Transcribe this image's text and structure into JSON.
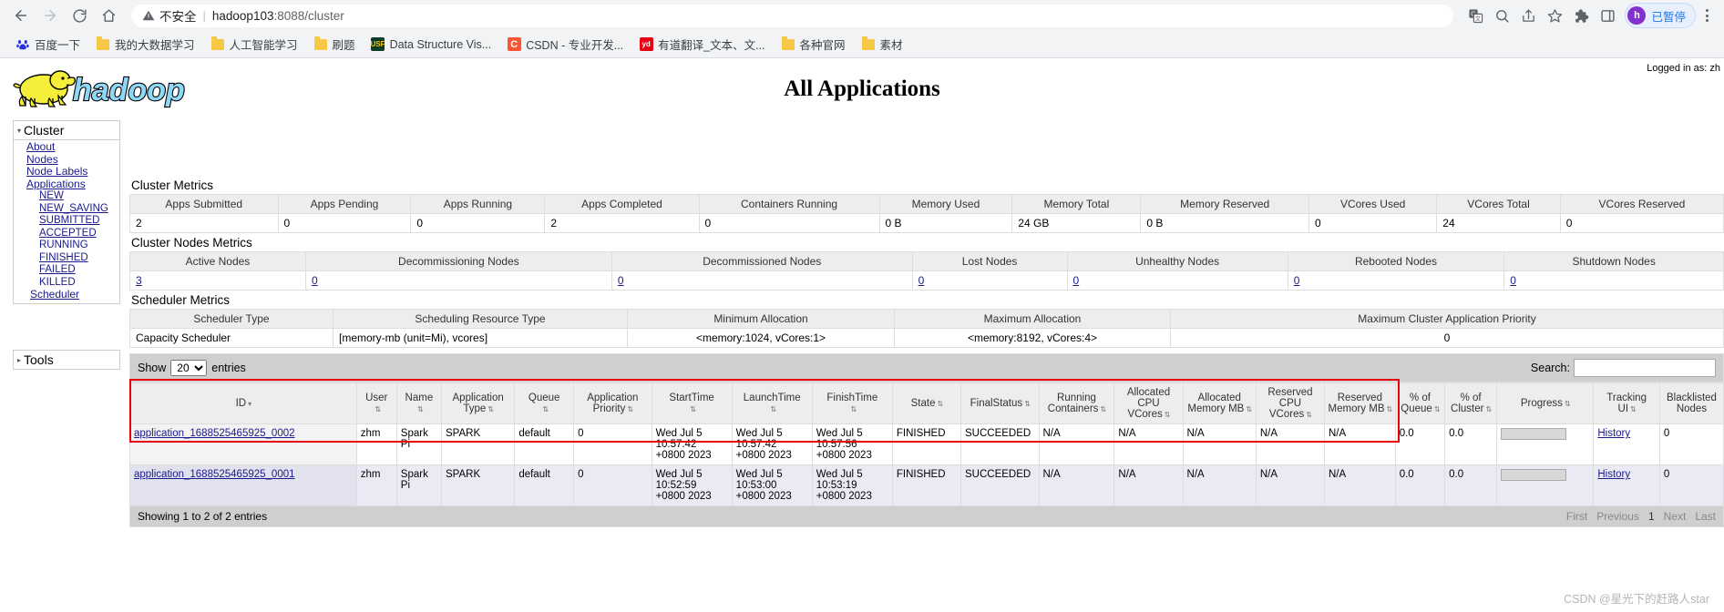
{
  "browser": {
    "security_label": "不安全",
    "url_host": "hadoop103",
    "url_rest": ":8088/cluster",
    "nav": {
      "back": "back-arrow",
      "forward": "forward-arrow",
      "reload": "reload",
      "home": "home"
    },
    "right_icons": [
      "translate",
      "zoom-out",
      "share",
      "bookmark-star",
      "extensions",
      "side-panel"
    ],
    "profile": {
      "initial": "h",
      "status": "已暂停"
    },
    "bookmarks": [
      {
        "label": "百度一下",
        "icon": "baidu"
      },
      {
        "label": "我的大数据学习",
        "icon": "folder"
      },
      {
        "label": "人工智能学习",
        "icon": "folder"
      },
      {
        "label": "刷题",
        "icon": "folder"
      },
      {
        "label": "Data Structure Vis...",
        "icon": "usf"
      },
      {
        "label": "CSDN - 专业开发...",
        "icon": "csdn"
      },
      {
        "label": "有道翻译_文本、文...",
        "icon": "youdao"
      },
      {
        "label": "各种官网",
        "icon": "folder"
      },
      {
        "label": "素材",
        "icon": "folder"
      }
    ]
  },
  "page": {
    "title": "All Applications",
    "logged_in": "Logged in as: zh",
    "watermark": "CSDN @星光下的赶路人star"
  },
  "sidebar": {
    "cluster_label": "Cluster",
    "links": [
      "About",
      "Nodes",
      "Node Labels",
      "Applications"
    ],
    "app_states": [
      "NEW",
      "NEW_SAVING",
      "SUBMITTED",
      "ACCEPTED",
      "RUNNING",
      "FINISHED",
      "FAILED",
      "KILLED"
    ],
    "scheduler_label": "Scheduler",
    "tools_label": "Tools"
  },
  "cluster_metrics": {
    "title": "Cluster Metrics",
    "headers": [
      "Apps Submitted",
      "Apps Pending",
      "Apps Running",
      "Apps Completed",
      "Containers Running",
      "Memory Used",
      "Memory Total",
      "Memory Reserved",
      "VCores Used",
      "VCores Total",
      "VCores Reserved"
    ],
    "values": [
      "2",
      "0",
      "0",
      "2",
      "0",
      "0 B",
      "24 GB",
      "0 B",
      "0",
      "24",
      "0"
    ]
  },
  "cluster_nodes_metrics": {
    "title": "Cluster Nodes Metrics",
    "headers": [
      "Active Nodes",
      "Decommissioning Nodes",
      "Decommissioned Nodes",
      "Lost Nodes",
      "Unhealthy Nodes",
      "Rebooted Nodes",
      "Shutdown Nodes"
    ],
    "values": [
      "3",
      "0",
      "0",
      "0",
      "0",
      "0",
      "0"
    ]
  },
  "scheduler_metrics": {
    "title": "Scheduler Metrics",
    "headers": [
      "Scheduler Type",
      "Scheduling Resource Type",
      "Minimum Allocation",
      "Maximum Allocation",
      "Maximum Cluster Application Priority"
    ],
    "values": [
      "Capacity Scheduler",
      "[memory-mb (unit=Mi), vcores]",
      "<memory:1024, vCores:1>",
      "<memory:8192, vCores:4>",
      "0"
    ]
  },
  "applications": {
    "show_label": "Show",
    "show_value": "20",
    "entries_label": "entries",
    "search_label": "Search:",
    "search_value": "",
    "columns": [
      "ID",
      "User",
      "Name",
      "Application Type",
      "Queue",
      "Application Priority",
      "StartTime",
      "LaunchTime",
      "FinishTime",
      "State",
      "FinalStatus",
      "Running Containers",
      "Allocated CPU VCores",
      "Allocated Memory MB",
      "Reserved CPU VCores",
      "Reserved Memory MB",
      "% of Queue",
      "% of Cluster",
      "Progress",
      "Tracking UI",
      "Blacklisted Nodes"
    ],
    "rows": [
      {
        "id": "application_1688525465925_0002",
        "user": "zhm",
        "name": "Spark Pi",
        "type": "SPARK",
        "queue": "default",
        "priority": "0",
        "start": "Wed Jul 5 10:57:42 +0800 2023",
        "launch": "Wed Jul 5 10:57:42 +0800 2023",
        "finish": "Wed Jul 5 10:57:56 +0800 2023",
        "state": "FINISHED",
        "final_status": "SUCCEEDED",
        "running_containers": "N/A",
        "alloc_vcores": "N/A",
        "alloc_mem": "N/A",
        "res_vcores": "N/A",
        "res_mem": "N/A",
        "pct_queue": "0.0",
        "pct_cluster": "0.0",
        "progress": "",
        "tracking": "History",
        "blacklisted": "0"
      },
      {
        "id": "application_1688525465925_0001",
        "user": "zhm",
        "name": "Spark Pi",
        "type": "SPARK",
        "queue": "default",
        "priority": "0",
        "start": "Wed Jul 5 10:52:59 +0800 2023",
        "launch": "Wed Jul 5 10:53:00 +0800 2023",
        "finish": "Wed Jul 5 10:53:19 +0800 2023",
        "state": "FINISHED",
        "final_status": "SUCCEEDED",
        "running_containers": "N/A",
        "alloc_vcores": "N/A",
        "alloc_mem": "N/A",
        "res_vcores": "N/A",
        "res_mem": "N/A",
        "pct_queue": "0.0",
        "pct_cluster": "0.0",
        "progress": "",
        "tracking": "History",
        "blacklisted": "0"
      }
    ],
    "footer_info": "Showing 1 to 2 of 2 entries",
    "pager": [
      "First",
      "Previous",
      "1",
      "Next",
      "Last"
    ]
  }
}
